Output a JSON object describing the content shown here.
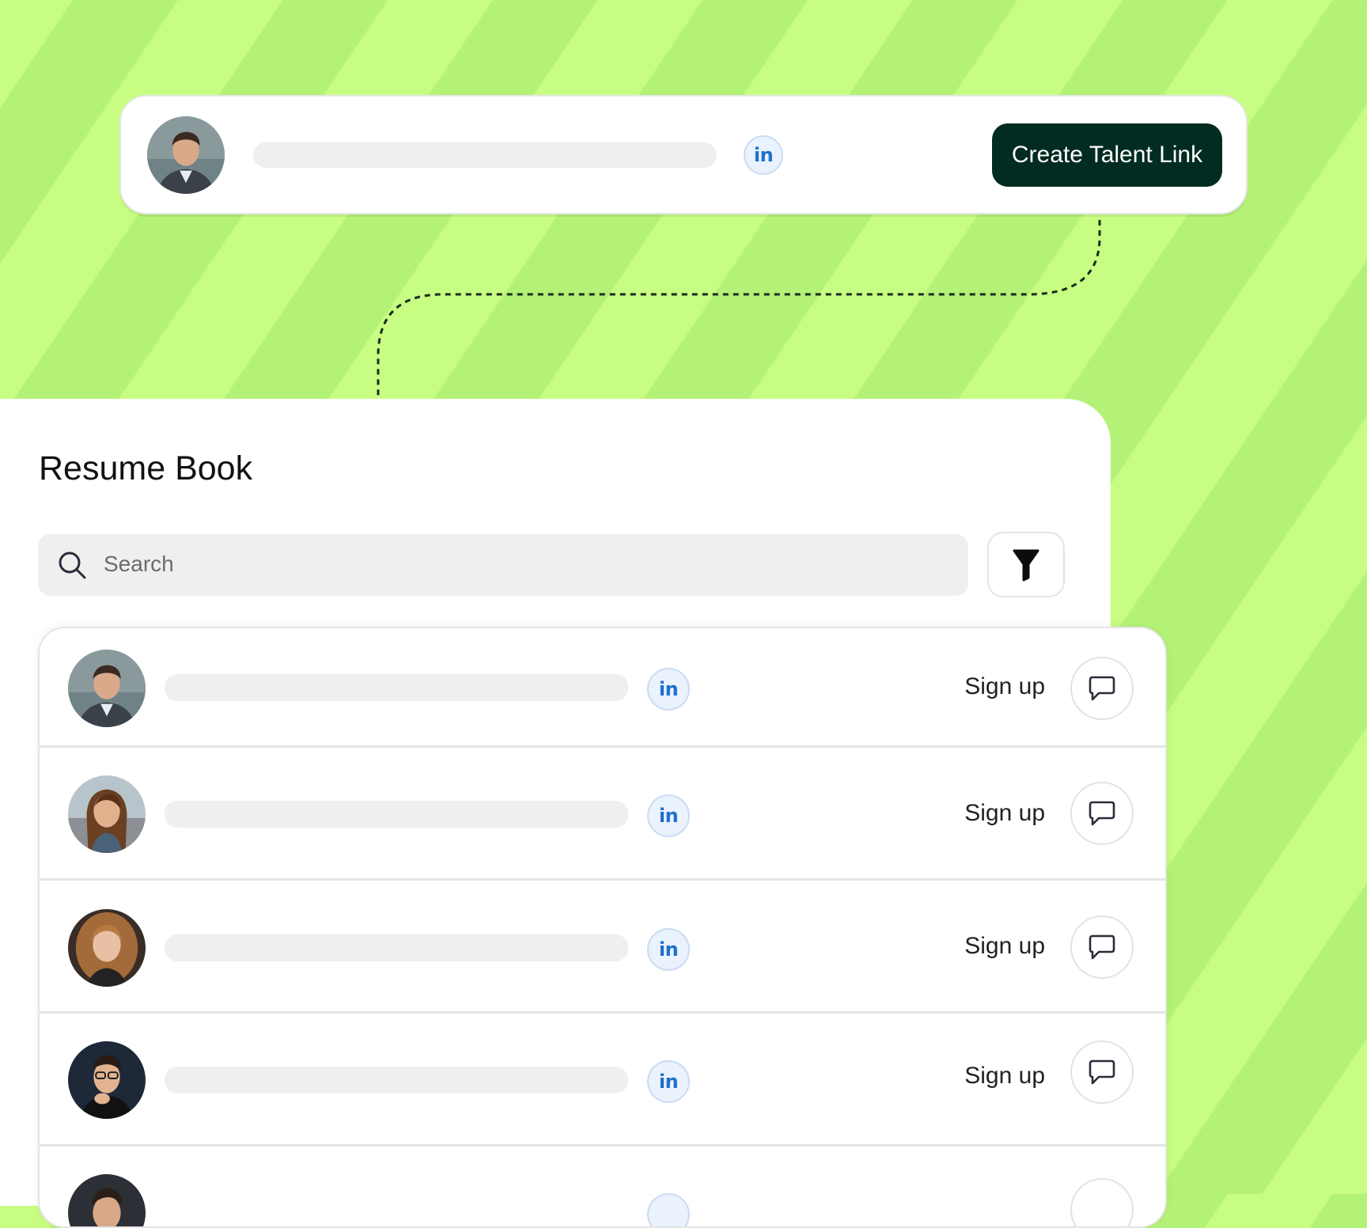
{
  "talent_card": {
    "linkedin_label": "in",
    "create_button_label": "Create Talent Link"
  },
  "resume_book": {
    "title": "Resume Book",
    "search": {
      "placeholder": "Search"
    },
    "rows": [
      {
        "linkedin_label": "in",
        "action_label": "Sign up"
      },
      {
        "linkedin_label": "in",
        "action_label": "Sign up"
      },
      {
        "linkedin_label": "in",
        "action_label": "Sign up"
      },
      {
        "linkedin_label": "in",
        "action_label": "Sign up"
      }
    ]
  },
  "colors": {
    "stripe_light": "#c7fd82",
    "stripe_dark": "#b4f277",
    "button_dark": "#022c22",
    "linkedin_blue": "#1f6fcd"
  },
  "icons": [
    "search-icon",
    "filter-icon",
    "linkedin-icon",
    "chat-bubble-icon"
  ]
}
